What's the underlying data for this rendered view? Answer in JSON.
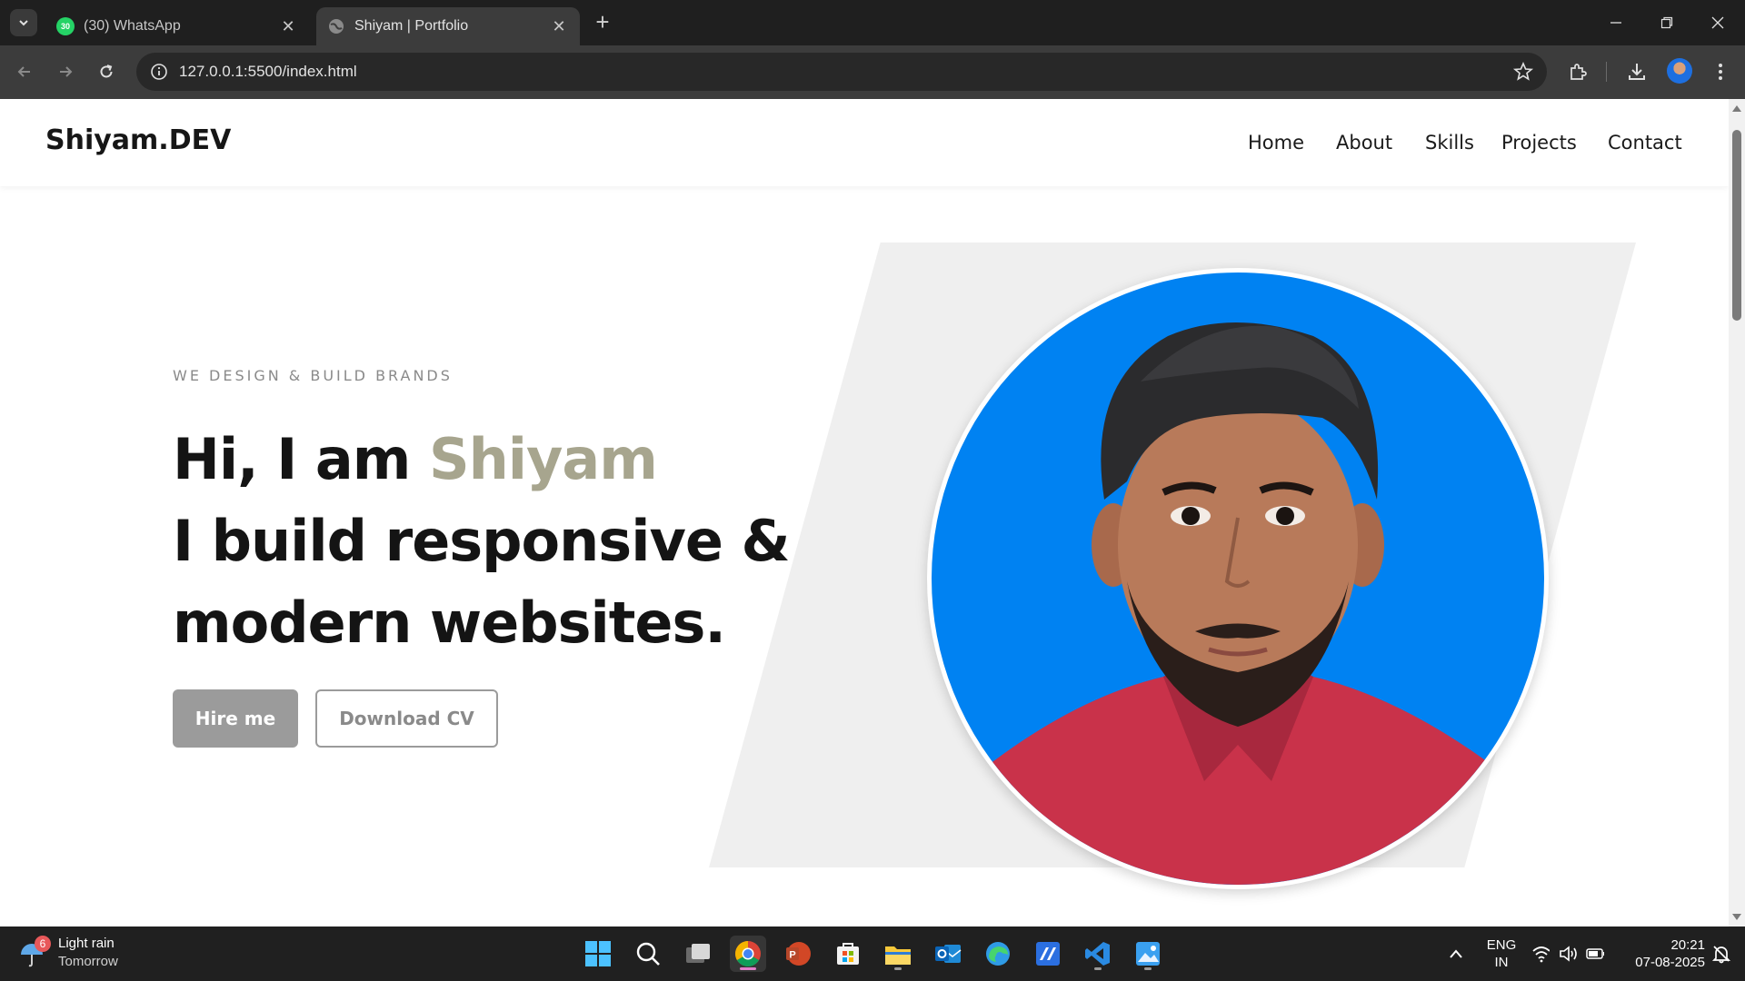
{
  "browser": {
    "tabs": [
      {
        "title": "(30) WhatsApp",
        "badge": "30",
        "active": false
      },
      {
        "title": "Shiyam | Portfolio",
        "active": true
      }
    ],
    "url": "127.0.0.1:5500/index.html"
  },
  "site": {
    "logo": "Shiyam.DEV",
    "nav": [
      "Home",
      "About",
      "Skills",
      "Projects",
      "Contact"
    ],
    "hero": {
      "eyebrow": "WE DESIGN & BUILD BRANDS",
      "greeting": "Hi, I am ",
      "name": "Shiyam",
      "line2": "I build responsive &",
      "line3": "modern websites.",
      "hire_button": "Hire me",
      "cv_button": "Download CV"
    },
    "colors": {
      "accent": "#a7a58e",
      "portrait_bg": "#0082f2",
      "button_gray": "#9b9b9b"
    }
  },
  "taskbar": {
    "weather": {
      "badge": "6",
      "line1": "Light rain",
      "line2": "Tomorrow"
    },
    "language": {
      "line1": "ENG",
      "line2": "IN"
    },
    "clock": {
      "time": "20:21",
      "date": "07-08-2025"
    },
    "apps": [
      "start-icon",
      "search-icon",
      "task-view-icon",
      "chrome-icon",
      "powerpoint-icon",
      "store-icon",
      "file-explorer-icon",
      "outlook-icon",
      "edge-icon",
      "app-icon",
      "vscode-icon",
      "photos-icon"
    ]
  }
}
